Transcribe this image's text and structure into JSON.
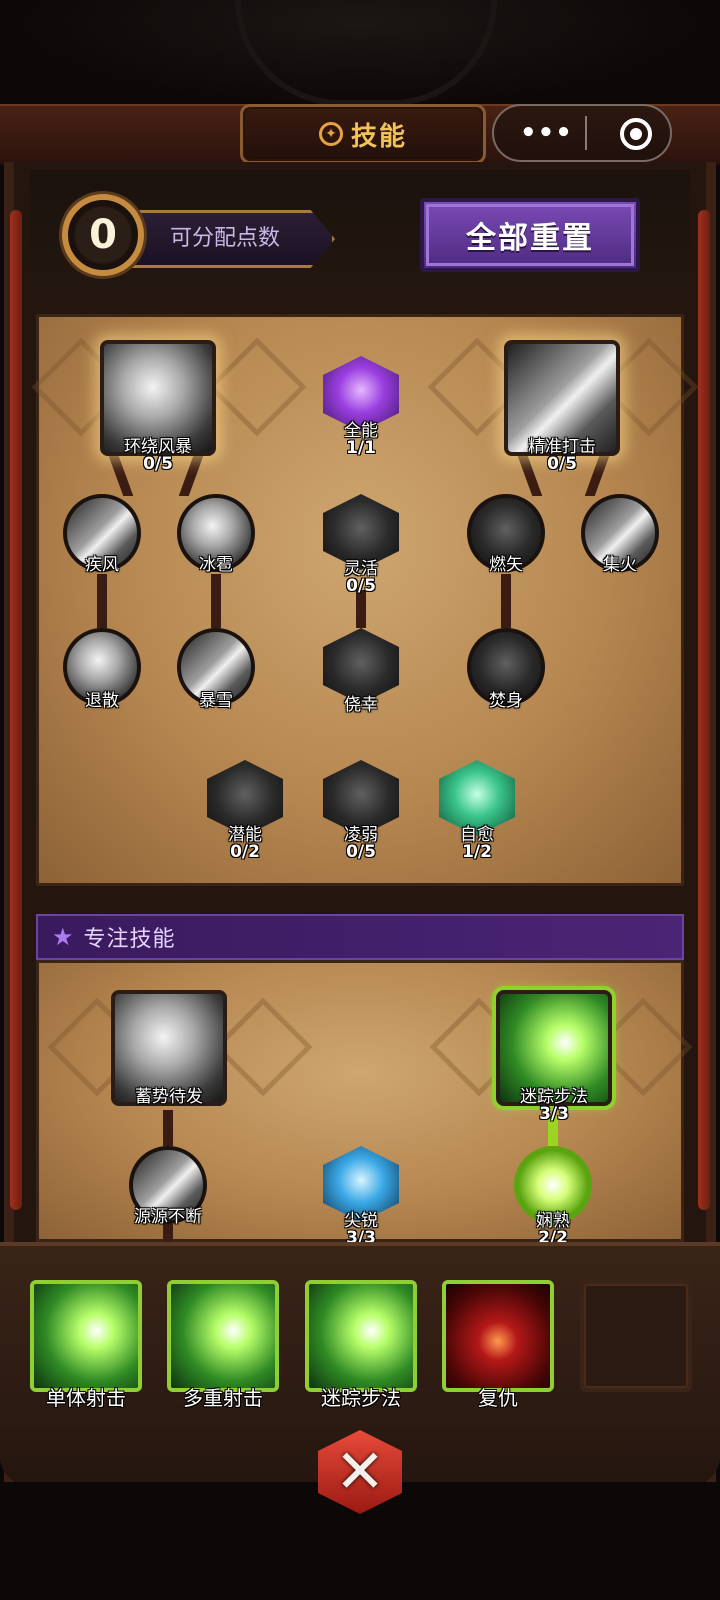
{
  "title": "技能",
  "title_icon": "pentagram-icon",
  "capsule": {
    "more_icon": "•••",
    "close_icon": "record-icon"
  },
  "points": {
    "value": "0",
    "label": "可分配点数"
  },
  "reset_button": "全部重置",
  "tree": {
    "top_left": {
      "label": "环绕风暴",
      "count": "0/5"
    },
    "top_mid": {
      "label": "全能",
      "count": "1/1"
    },
    "top_right": {
      "label": "精准打击",
      "count": "0/5"
    },
    "r2": [
      {
        "label": "疾风"
      },
      {
        "label": "冰雹"
      },
      {
        "label": "灵活",
        "count": "0/5"
      },
      {
        "label": "燃矢"
      },
      {
        "label": "集火"
      }
    ],
    "r3": [
      {
        "label": "退散"
      },
      {
        "label": "暴雪"
      },
      {
        "label": "侥幸"
      },
      {
        "label": "焚身"
      }
    ],
    "r4": [
      {
        "label": "潜能",
        "count": "0/2"
      },
      {
        "label": "凌弱",
        "count": "0/5"
      },
      {
        "label": "自愈",
        "count": "1/2"
      }
    ]
  },
  "focus": {
    "title": "专注技能",
    "left_big": {
      "label": "蓄势待发"
    },
    "right_big": {
      "label": "迷踪步法",
      "count": "3/3"
    },
    "row2": [
      {
        "label": "源源不断"
      },
      {
        "label": "尖锐",
        "count": "3/3"
      },
      {
        "label": "娴熟",
        "count": "2/2"
      }
    ]
  },
  "slots": [
    {
      "label": "单体射击"
    },
    {
      "label": "多重射击"
    },
    {
      "label": "迷踪步法"
    },
    {
      "label": "复仇"
    },
    {
      "label": ""
    }
  ],
  "close_icon": "close-x-icon",
  "close_glyph": "✕"
}
